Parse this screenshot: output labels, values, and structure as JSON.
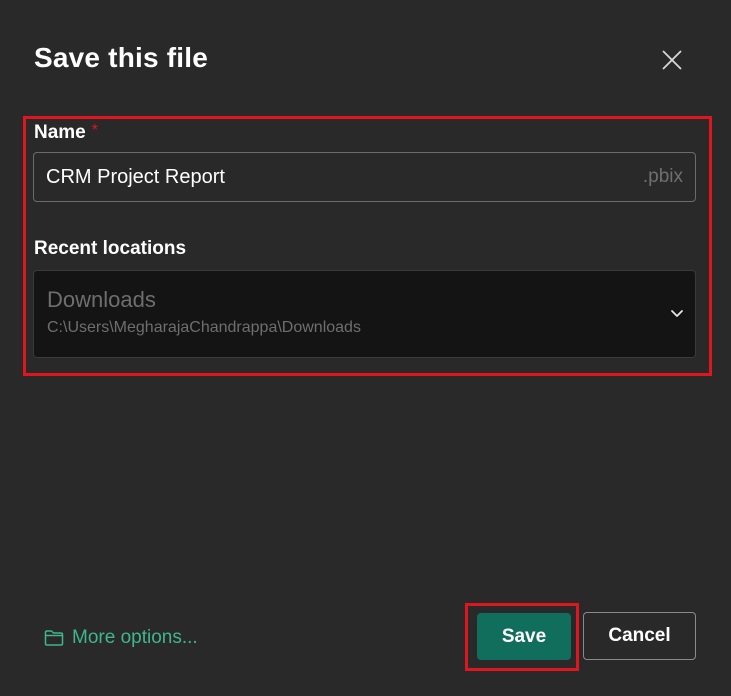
{
  "dialog": {
    "title": "Save this file"
  },
  "name_field": {
    "label": "Name",
    "required_mark": "*",
    "value": "CRM Project Report",
    "extension": ".pbix"
  },
  "location_field": {
    "label": "Recent locations",
    "selected_name": "Downloads",
    "selected_path": "C:\\Users\\MegharajaChandrappa\\Downloads"
  },
  "footer": {
    "more_options_label": "More options...",
    "save_label": "Save",
    "cancel_label": "Cancel"
  },
  "icons": {
    "close": "close-icon",
    "chevron": "chevron-down-icon",
    "folder": "folder-icon"
  },
  "colors": {
    "background": "#292929",
    "accent_link": "#3fb58e",
    "primary_button": "#116e5c",
    "highlight": "#e0161f",
    "required": "#e0161f"
  }
}
